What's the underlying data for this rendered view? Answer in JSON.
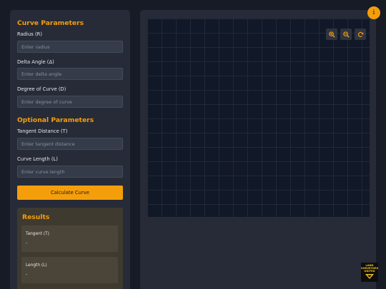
{
  "sidebar": {
    "curve_title": "Curve Parameters",
    "radius_label": "Radius (R)",
    "radius_placeholder": "Enter radius",
    "delta_label": "Delta Angle (Δ)",
    "delta_placeholder": "Enter delta angle",
    "degree_label": "Degree of Curve (D)",
    "degree_placeholder": "Enter degree of curve",
    "optional_title": "Optional Parameters",
    "tangent_label": "Tangent Distance (T)",
    "tangent_placeholder": "Enter tangent distance",
    "length_label": "Curve Length (L)",
    "length_placeholder": "Enter curve length",
    "calculate_label": "Calculate Curve"
  },
  "results": {
    "title": "Results",
    "tangent_label": "Tangent (T)",
    "tangent_value": "-",
    "length_label": "Length (L)",
    "length_value": "-"
  },
  "toolbar": {
    "zoom_in_icon": "zoom-in-icon",
    "zoom_out_icon": "zoom-out-icon",
    "reset_icon": "reset-icon"
  },
  "info": {
    "glyph": "i"
  },
  "logo": {
    "line1": "LAND",
    "line2": "SURVEYORS",
    "line3": "UNITED"
  },
  "colors": {
    "accent": "#f59e0b",
    "panel": "#262b37",
    "background": "#161b26"
  }
}
